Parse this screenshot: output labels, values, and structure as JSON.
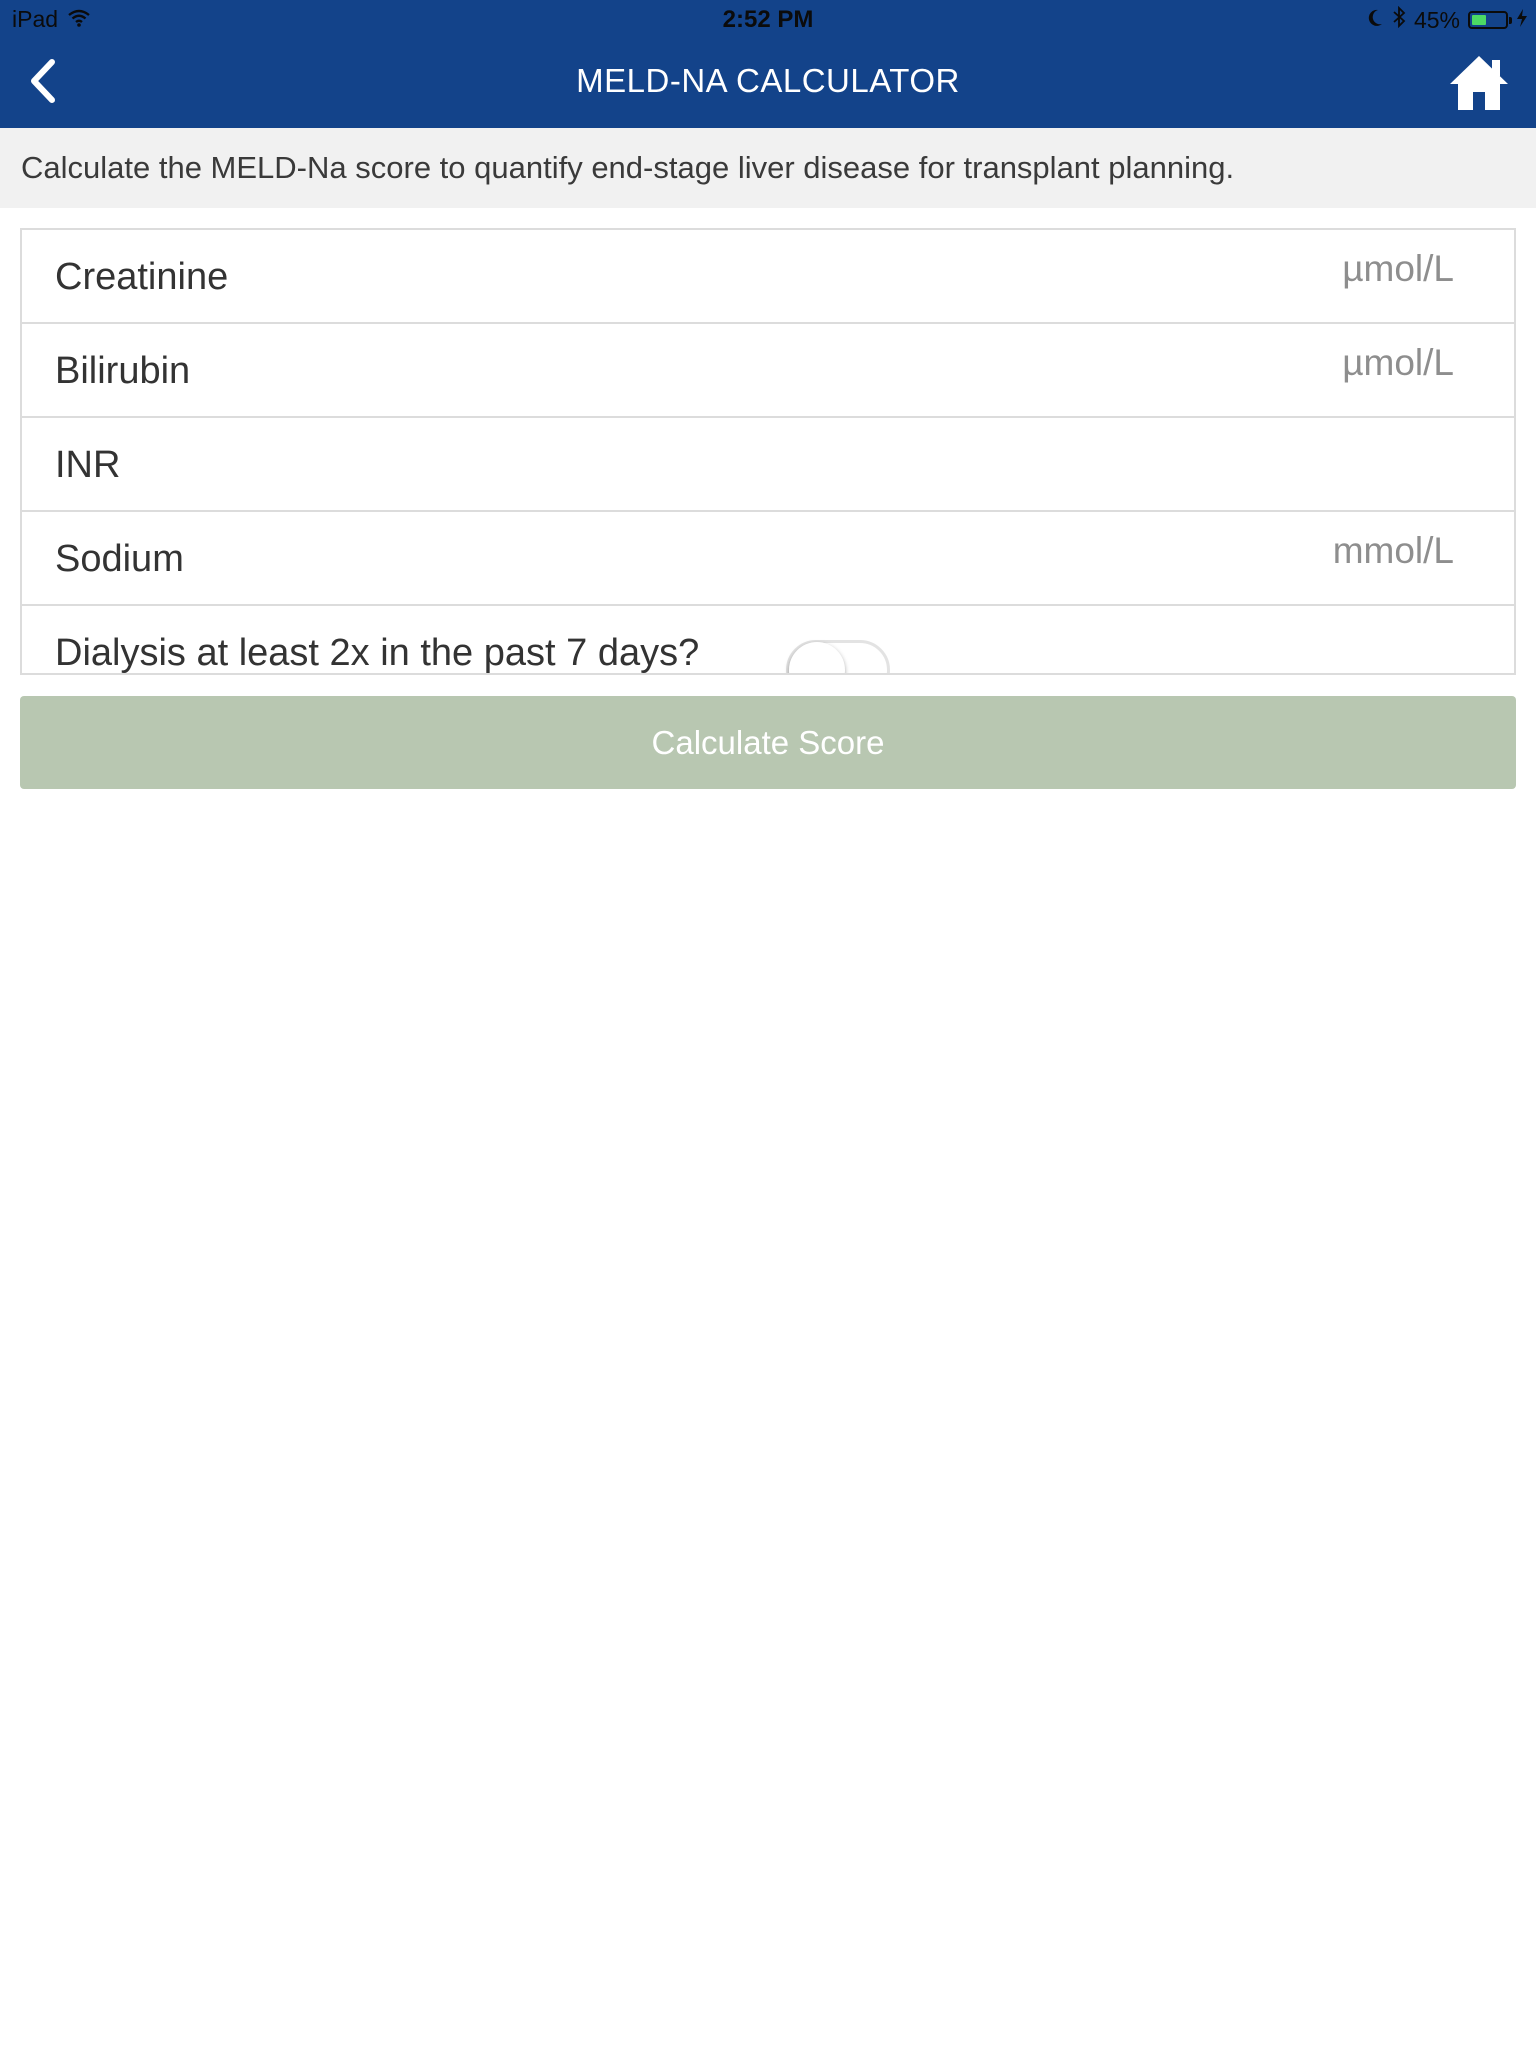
{
  "status_bar": {
    "device": "iPad",
    "time": "2:52 PM",
    "battery_percent": "45%",
    "battery_level": 0.45,
    "icons": [
      "wifi-icon",
      "moon-icon",
      "bluetooth-icon",
      "battery-icon",
      "charging-bolt-icon"
    ]
  },
  "nav": {
    "title": "MELD-NA CALCULATOR",
    "back_icon": "chevron-left-icon",
    "home_icon": "home-icon",
    "background_color": "#13438a"
  },
  "description": "Calculate the MELD-Na score to quantify end-stage liver disease for transplant planning.",
  "fields": [
    {
      "label": "Creatinine",
      "unit": "µmol/L",
      "value": ""
    },
    {
      "label": "Bilirubin",
      "unit": "µmol/L",
      "value": ""
    },
    {
      "label": "INR",
      "unit": "",
      "value": ""
    },
    {
      "label": "Sodium",
      "unit": "mmol/L",
      "value": ""
    }
  ],
  "dialysis": {
    "label": "Dialysis at least 2x in the past 7 days?",
    "checked": false
  },
  "calculate_button": {
    "label": "Calculate Score",
    "color": "#b8c7b1",
    "enabled": false
  }
}
